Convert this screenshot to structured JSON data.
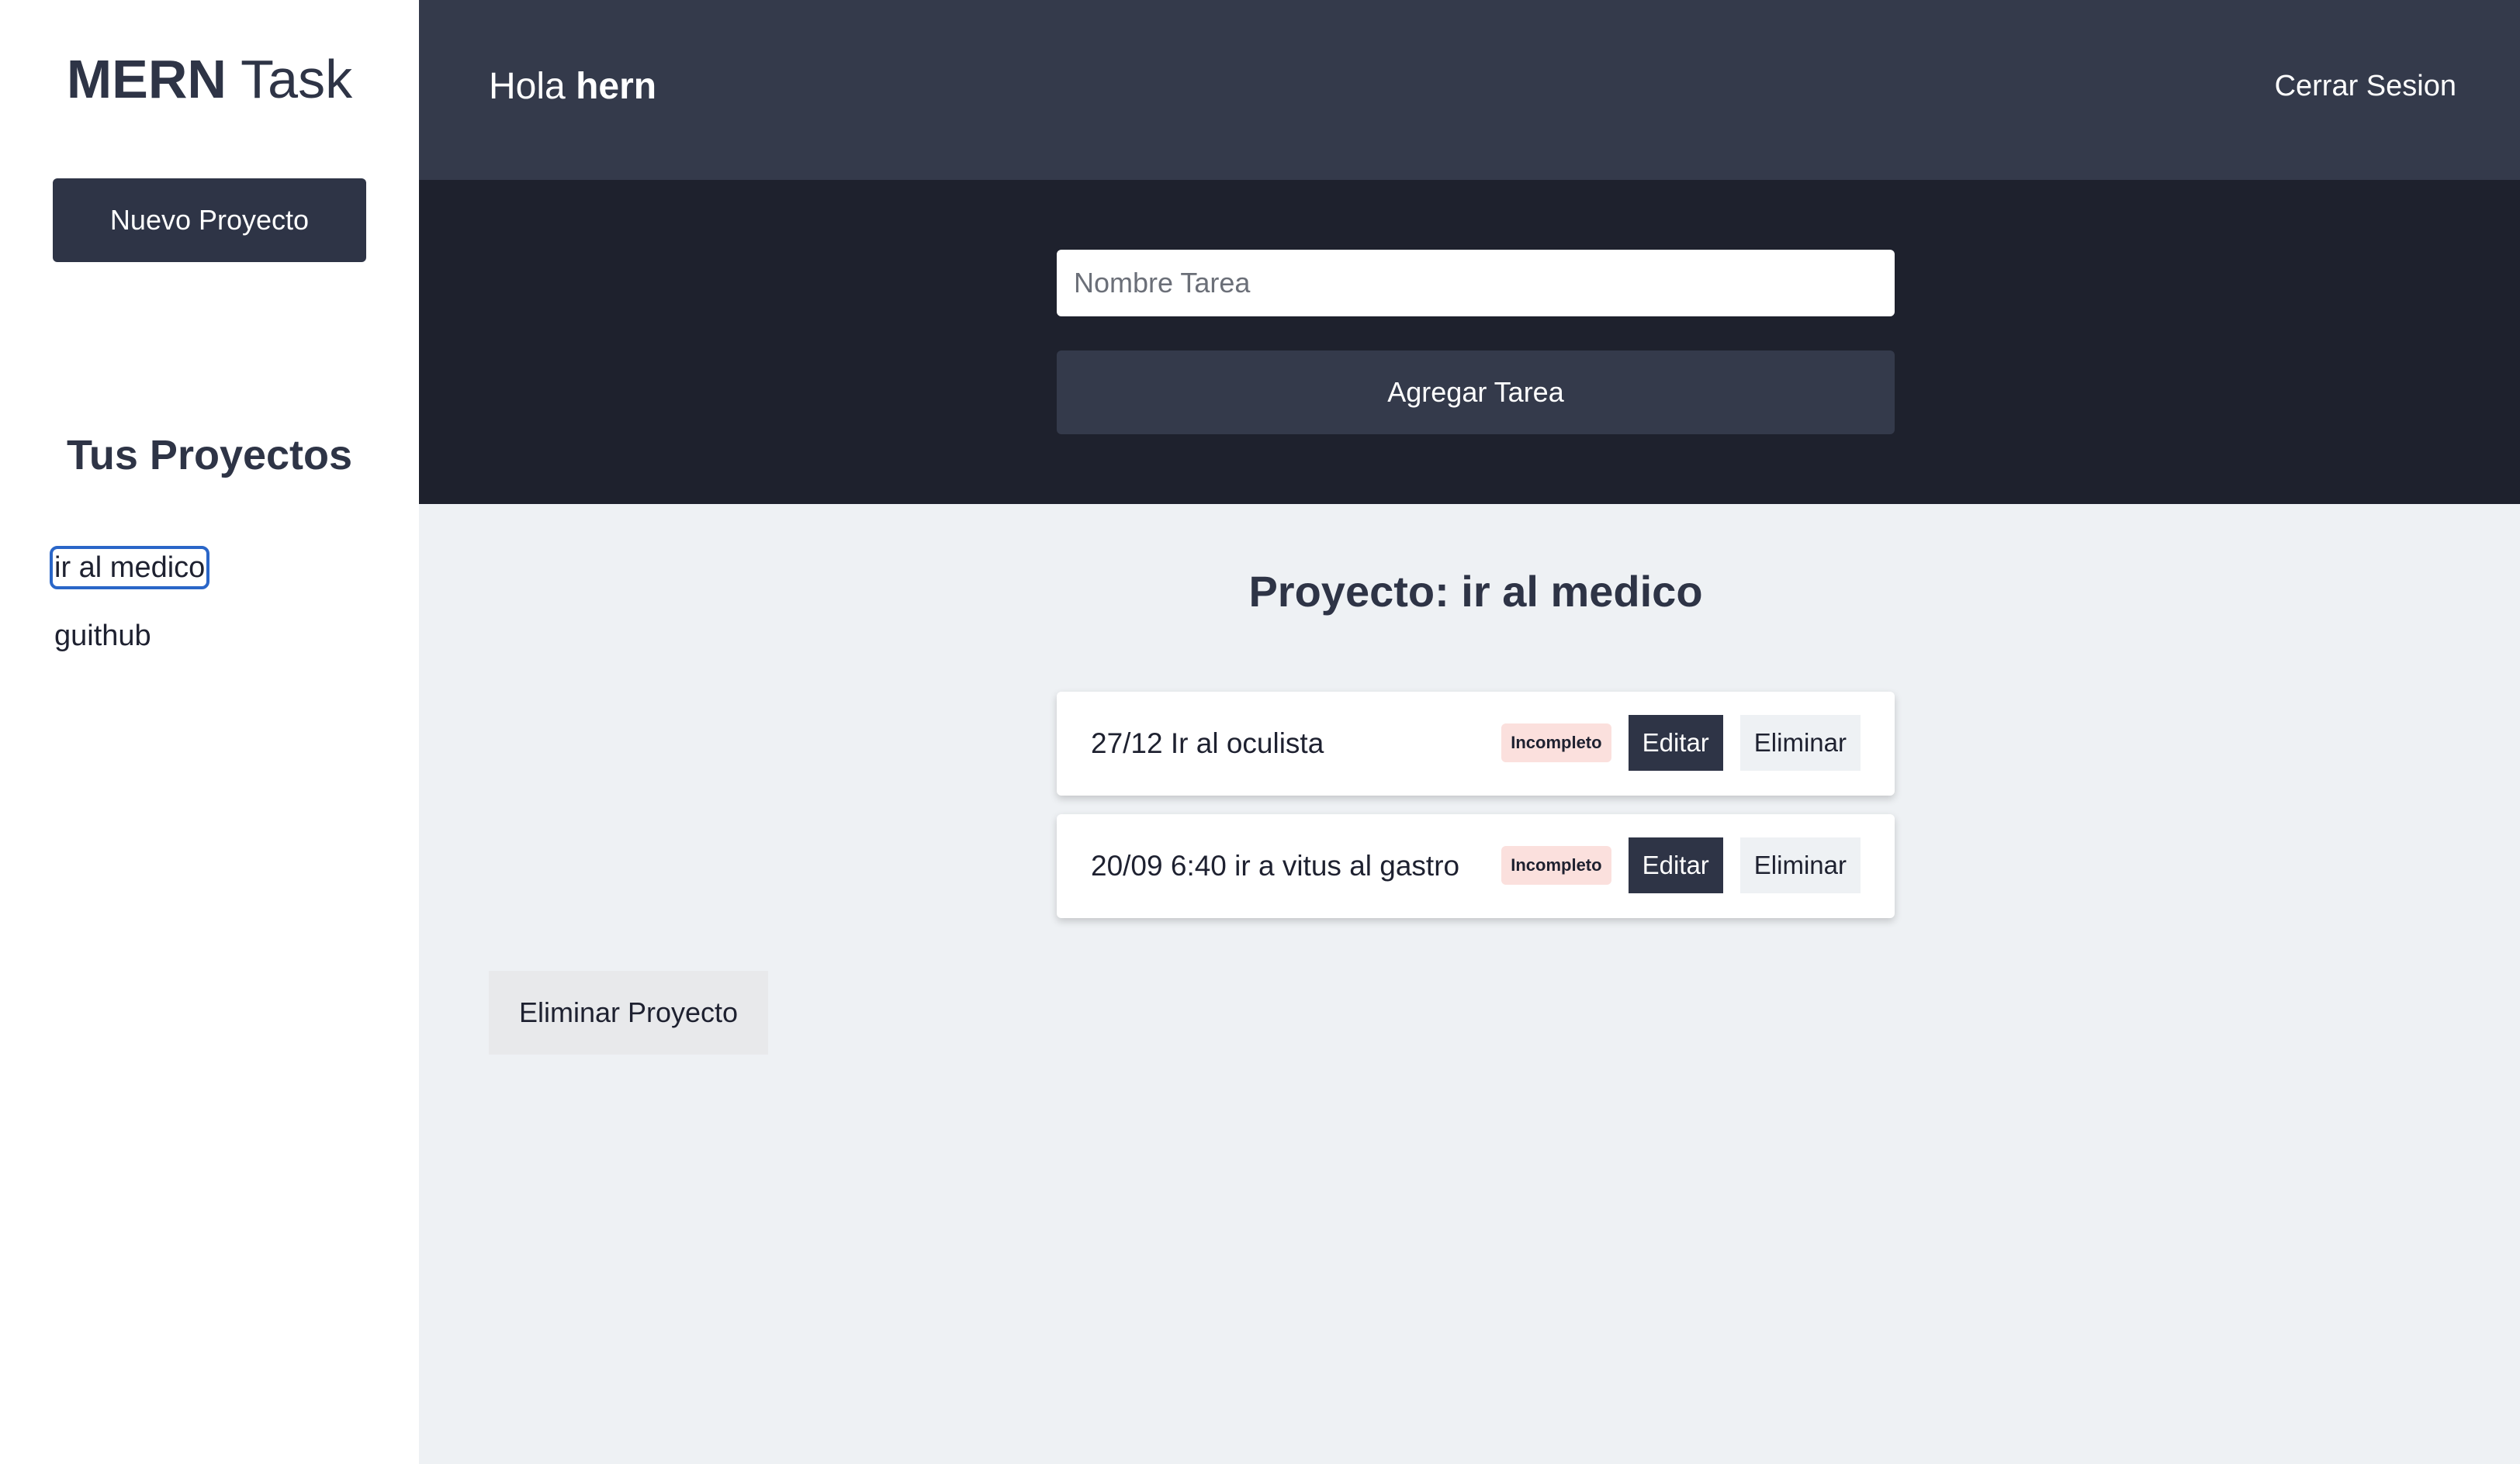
{
  "sidebar": {
    "logo_bold": "MERN",
    "logo_light": "Task",
    "new_project_label": "Nuevo Proyecto",
    "projects_title": "Tus Proyectos",
    "projects": [
      {
        "label": "ir al medico",
        "selected": true
      },
      {
        "label": "guithub",
        "selected": false
      }
    ]
  },
  "header": {
    "greeting": "Hola",
    "user": "hern",
    "logout_label": "Cerrar Sesion"
  },
  "task_form": {
    "placeholder": "Nombre Tarea",
    "submit_label": "Agregar Tarea"
  },
  "main": {
    "project_heading": "Proyecto: ir al medico",
    "tasks": [
      {
        "name": "27/12 Ir al oculista",
        "status": "Incompleto",
        "edit_label": "Editar",
        "delete_label": "Eliminar"
      },
      {
        "name": "20/09 6:40 ir a vitus al gastro",
        "status": "Incompleto",
        "edit_label": "Editar",
        "delete_label": "Eliminar"
      }
    ],
    "delete_project_label": "Eliminar Proyecto"
  },
  "colors": {
    "sidebar_button": "#2e3446",
    "header_bg": "#343a4b",
    "form_bg": "#1e212d",
    "main_bg": "#eef1f4",
    "badge_incomplete": "#fbe0dd",
    "focus_outline": "#2a66c8"
  }
}
